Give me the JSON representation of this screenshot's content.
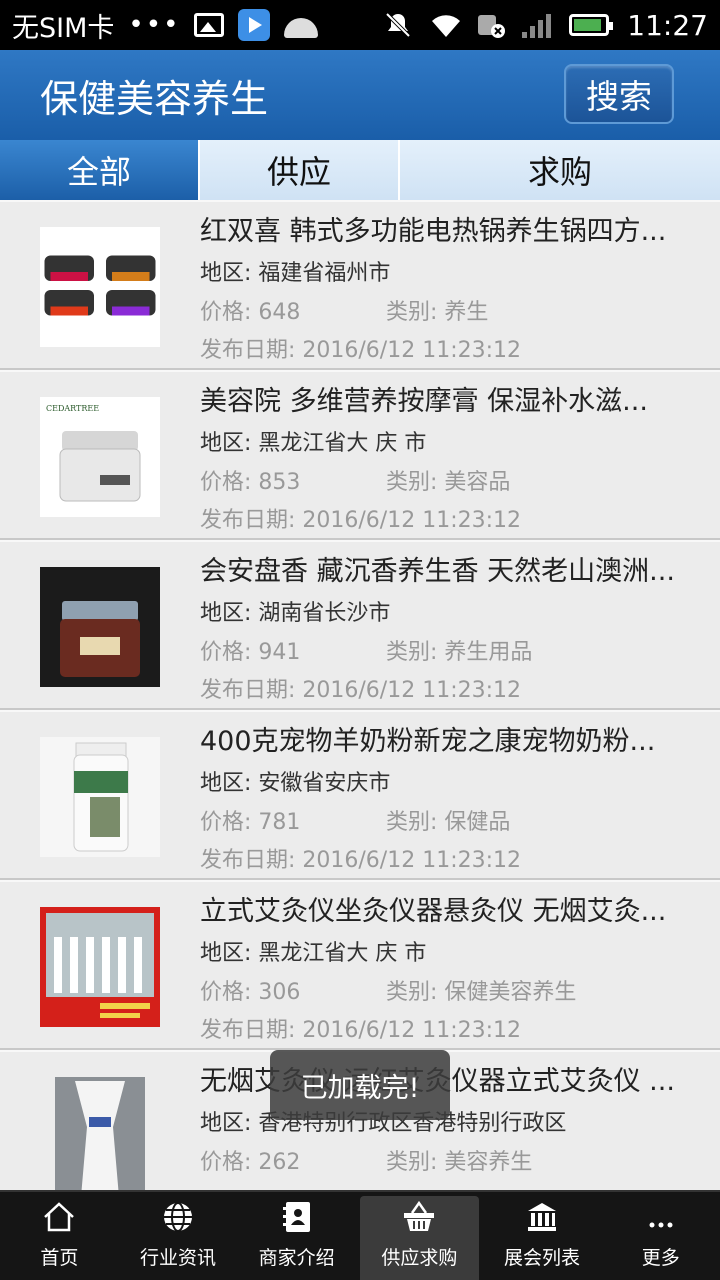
{
  "status_bar": {
    "carrier": "无SIM卡",
    "dots": "•••",
    "time": "11:27",
    "battery_level": 0.9
  },
  "header": {
    "title": "保健美容养生",
    "search_label": "搜索"
  },
  "tabs": [
    {
      "label": "全部",
      "active": true
    },
    {
      "label": "供应",
      "active": false
    },
    {
      "label": "求购",
      "active": false
    }
  ],
  "labels": {
    "region": "地区: ",
    "price": "价格: ",
    "category": "类别: ",
    "date": "发布日期: "
  },
  "items": [
    {
      "title": "红双喜 韩式多功能电热锅养生锅四方...",
      "region": "福建省福州市",
      "price": "648",
      "category": "养生",
      "date": "2016/6/12 11:23:12"
    },
    {
      "title": "美容院 多维营养按摩膏 保湿补水滋...",
      "region": "黑龙江省大 庆 市",
      "price": "853",
      "category": "美容品",
      "date": "2016/6/12 11:23:12"
    },
    {
      "title": "会安盘香 藏沉香养生香 天然老山澳洲...",
      "region": "湖南省长沙市",
      "price": "941",
      "category": "养生用品",
      "date": "2016/6/12 11:23:12"
    },
    {
      "title": "400克宠物羊奶粉新宠之康宠物奶粉...",
      "region": "安徽省安庆市",
      "price": "781",
      "category": "保健品",
      "date": "2016/6/12 11:23:12"
    },
    {
      "title": "立式艾灸仪坐灸仪器悬灸仪 无烟艾灸...",
      "region": "黑龙江省大 庆 市",
      "price": "306",
      "category": "保健美容养生",
      "date": "2016/6/12 11:23:12"
    },
    {
      "title": "无烟艾灸仪 远红艾灸仪器立式艾灸仪 ...",
      "region": "香港特别行政区香港特别行政区",
      "price": "262",
      "category": "美容养生",
      "date": ""
    }
  ],
  "toast": "已加载完!",
  "bottom_nav": [
    {
      "label": "首页",
      "icon": "home-icon",
      "active": false
    },
    {
      "label": "行业资讯",
      "icon": "globe-icon",
      "active": false
    },
    {
      "label": "商家介绍",
      "icon": "contact-book-icon",
      "active": false
    },
    {
      "label": "供应求购",
      "icon": "basket-icon",
      "active": true
    },
    {
      "label": "展会列表",
      "icon": "bank-icon",
      "active": false
    },
    {
      "label": "更多",
      "icon": "more-icon",
      "active": false
    }
  ]
}
